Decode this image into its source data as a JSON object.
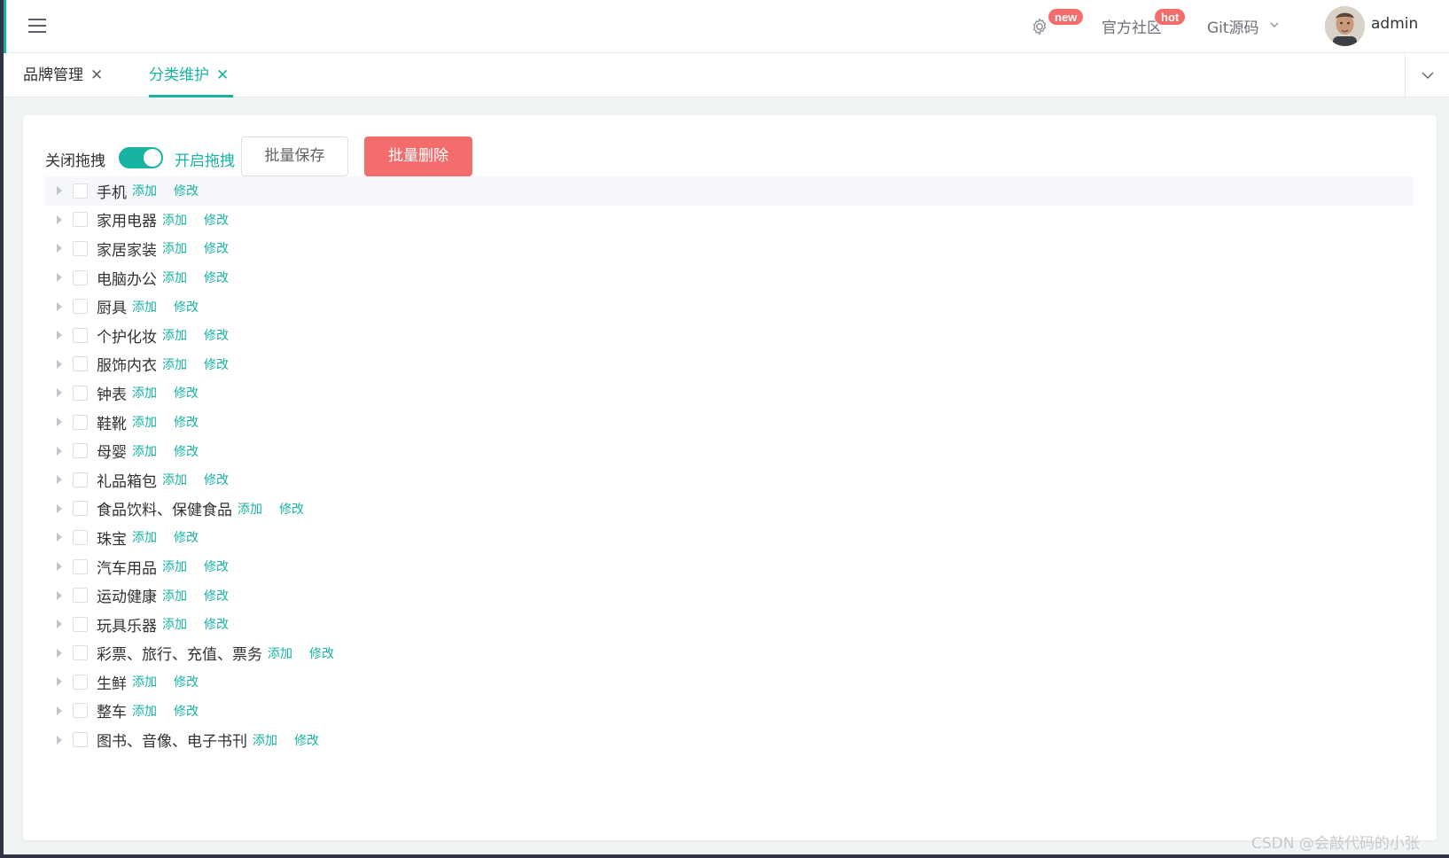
{
  "header": {
    "badge_new": "new",
    "community": "官方社区",
    "badge_hot": "hot",
    "git": "Git源码",
    "username": "admin",
    "icons": [
      "menu-icon",
      "gear-icon",
      "chevron-down-icon",
      "avatar"
    ]
  },
  "tabs": [
    {
      "label": "品牌管理",
      "close": "✕",
      "active": false
    },
    {
      "label": "分类维护",
      "close": "✕",
      "active": true
    }
  ],
  "toolbar": {
    "drag_off_label": "关闭拖拽",
    "drag_on_label": "开启拖拽",
    "drag_enabled": true,
    "batch_save": "批量保存",
    "batch_delete": "批量删除"
  },
  "tree": {
    "add_label": "添加",
    "edit_label": "修改",
    "nodes": [
      "手机",
      "家用电器",
      "家居家装",
      "电脑办公",
      "厨具",
      "个护化妆",
      "服饰内衣",
      "钟表",
      "鞋靴",
      "母婴",
      "礼品箱包",
      "食品饮料、保健食品",
      "珠宝",
      "汽车用品",
      "运动健康",
      "玩具乐器",
      "彩票、旅行、充值、票务",
      "生鲜",
      "整车",
      "图书、音像、电子书刊"
    ]
  },
  "watermark": "CSDN @会敲代码的小张",
  "colors": {
    "accent": "#17b3a3",
    "danger": "#f56c6c",
    "sidebar_edge": "#2f3447"
  }
}
